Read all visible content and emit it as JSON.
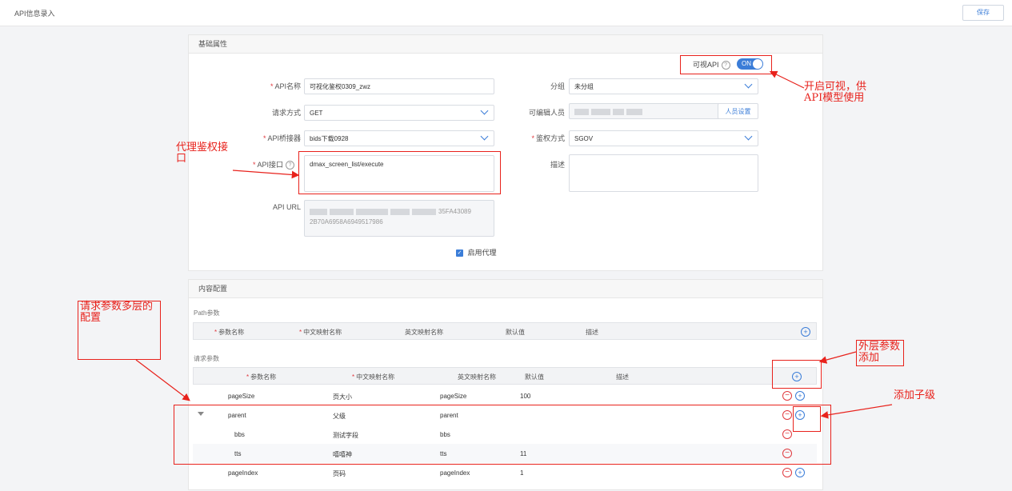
{
  "header": {
    "title": "API信息录入",
    "save_label": "保存"
  },
  "basic": {
    "section_title": "基础属性",
    "visible_api_label": "可视API",
    "toggle_label": "ON",
    "api_name_label": "API名称",
    "api_name_value": "可视化鉴权0309_zwz",
    "method_label": "请求方式",
    "method_value": "GET",
    "bridge_label": "API桥接器",
    "bridge_value": "bids下载0928",
    "api_interface_label": "API接口",
    "api_interface_value": "dmax_screen_list/execute",
    "api_url_label": "API URL",
    "api_url_visible_1": "35FA43089",
    "api_url_visible_2": "2B70A6958A6949517986",
    "proxy_label": "启用代理",
    "group_label": "分组",
    "group_value": "未分组",
    "editor_label": "可编辑人员",
    "editor_button": "人员设置",
    "auth_label": "鉴权方式",
    "auth_value": "SGOV",
    "desc_label": "描述"
  },
  "content": {
    "section_title": "内容配置",
    "path_params_label": "Path参数",
    "request_params_label": "请求参数",
    "columns": {
      "param_name": "参数名称",
      "cn_name": "中文映射名称",
      "en_name": "英文映射名称",
      "default": "默认值",
      "desc": "描述"
    },
    "rows": [
      {
        "name": "pageSize",
        "cn": "页大小",
        "en": "pageSize",
        "default": "100"
      },
      {
        "name": "parent",
        "cn": "父级",
        "en": "parent",
        "default": ""
      },
      {
        "name": "bbs",
        "cn": "测试字段",
        "en": "bbs",
        "default": ""
      },
      {
        "name": "tts",
        "cn": "嘻嘻神",
        "en": "tts",
        "default": "11"
      },
      {
        "name": "pageIndex",
        "cn": "页码",
        "en": "pageIndex",
        "default": "1"
      }
    ]
  },
  "annotations": {
    "visible_api": "开启可视，供API模型使用",
    "proxy_auth": "代理鉴权接口",
    "multi_level": "请求参数多层的配置",
    "outer_add": "外层参数添加",
    "child_add": "添加子级"
  },
  "colors": {
    "accent": "#3b7dd8",
    "annotation": "#e8221c",
    "required": "#e0393e"
  }
}
